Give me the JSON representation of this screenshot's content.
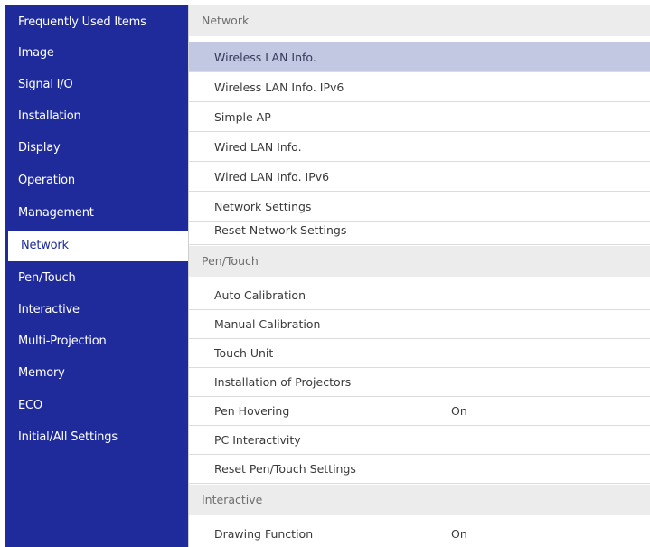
{
  "sidebar": {
    "items": [
      {
        "label": "Frequently Used Items"
      },
      {
        "label": "Image"
      },
      {
        "label": "Signal I/O"
      },
      {
        "label": "Installation"
      },
      {
        "label": "Display"
      },
      {
        "label": "Operation"
      },
      {
        "label": "Management"
      },
      {
        "label": "Network"
      },
      {
        "label": "Pen/Touch"
      },
      {
        "label": "Interactive"
      },
      {
        "label": "Multi-Projection"
      },
      {
        "label": "Memory"
      },
      {
        "label": "ECO"
      },
      {
        "label": "Initial/All Settings"
      }
    ],
    "active_index": 7
  },
  "main": {
    "network": {
      "header": "Network",
      "items": [
        {
          "label": "Wireless LAN Info."
        },
        {
          "label": "Wireless LAN Info. IPv6"
        },
        {
          "label": "Simple AP"
        },
        {
          "label": "Wired LAN Info."
        },
        {
          "label": "Wired LAN Info. IPv6"
        },
        {
          "label": "Network Settings"
        },
        {
          "label": "Reset Network Settings"
        }
      ]
    },
    "pen_touch": {
      "header": "Pen/Touch",
      "items": [
        {
          "label": "Auto Calibration",
          "value": ""
        },
        {
          "label": "Manual Calibration",
          "value": ""
        },
        {
          "label": "Touch Unit",
          "value": ""
        },
        {
          "label": "Installation of Projectors",
          "value": ""
        },
        {
          "label": "Pen Hovering",
          "value": "On"
        },
        {
          "label": "PC Interactivity",
          "value": ""
        },
        {
          "label": "Reset Pen/Touch Settings",
          "value": ""
        }
      ]
    },
    "interactive": {
      "header": "Interactive",
      "items": [
        {
          "label": "Drawing Function",
          "value": "On"
        }
      ]
    }
  },
  "colors": {
    "sidebar_bg": "#1f2b9a",
    "selected_row_bg": "#c3c8e2",
    "section_header_bg": "#ececec"
  }
}
